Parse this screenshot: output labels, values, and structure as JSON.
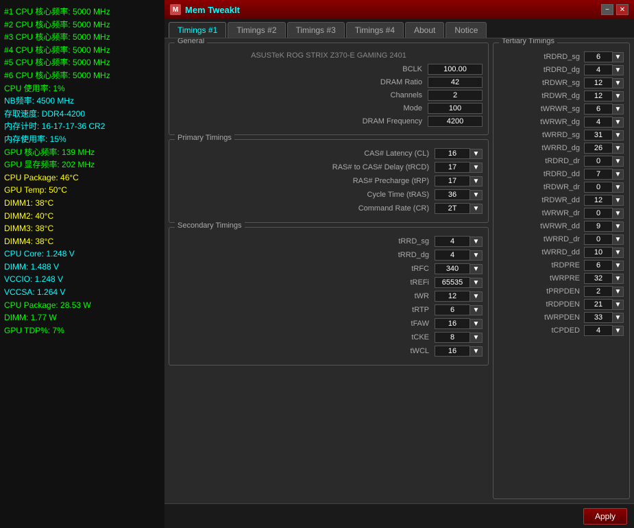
{
  "sidebar": {
    "lines": [
      {
        "text": "#1 CPU 核心频率: 5000 MHz",
        "class": "green"
      },
      {
        "text": "#2 CPU 核心频率: 5000 MHz",
        "class": "green"
      },
      {
        "text": "#3 CPU 核心频率: 5000 MHz",
        "class": "green"
      },
      {
        "text": "#4 CPU 核心频率: 5000 MHz",
        "class": "green"
      },
      {
        "text": "#5 CPU 核心频率: 5000 MHz",
        "class": "green"
      },
      {
        "text": "#6 CPU 核心频率: 5000 MHz",
        "class": "green"
      },
      {
        "text": "CPU 使用率: 1%",
        "class": "green"
      },
      {
        "text": "NB频率: 4500 MHz",
        "class": "cyan"
      },
      {
        "text": "存取速度: DDR4-4200",
        "class": "cyan"
      },
      {
        "text": "内存计时: 16-17-17-36 CR2",
        "class": "cyan"
      },
      {
        "text": "内存使用率: 15%",
        "class": "cyan"
      },
      {
        "text": "GPU 核心频率: 139 MHz",
        "class": "green"
      },
      {
        "text": "GPU 显存频率: 202 MHz",
        "class": "green"
      },
      {
        "text": "CPU Package: 46°C",
        "class": "yellow"
      },
      {
        "text": "GPU Temp: 50°C",
        "class": "yellow"
      },
      {
        "text": "DIMM1: 38°C",
        "class": "yellow"
      },
      {
        "text": "DIMM2: 40°C",
        "class": "yellow"
      },
      {
        "text": "DIMM3: 38°C",
        "class": "yellow"
      },
      {
        "text": "DIMM4: 38°C",
        "class": "yellow"
      },
      {
        "text": "CPU Core: 1.248 V",
        "class": "cyan"
      },
      {
        "text": "DIMM: 1.488 V",
        "class": "cyan"
      },
      {
        "text": "VCCIO: 1.248 V",
        "class": "cyan"
      },
      {
        "text": "VCCSA: 1.264 V",
        "class": "cyan"
      },
      {
        "text": "CPU Package: 28.53 W",
        "class": "green"
      },
      {
        "text": "DIMM: 1.77 W",
        "class": "green"
      },
      {
        "text": "GPU TDP%: 7%",
        "class": "green"
      }
    ]
  },
  "window": {
    "title": "Mem TweakIt",
    "minimize": "−",
    "close": "✕"
  },
  "tabs": [
    {
      "label": "Timings #1",
      "active": true
    },
    {
      "label": "Timings #2",
      "active": false
    },
    {
      "label": "Timings #3",
      "active": false
    },
    {
      "label": "Timings #4",
      "active": false
    },
    {
      "label": "About",
      "active": false
    },
    {
      "label": "Notice",
      "active": false
    }
  ],
  "general": {
    "title": "General",
    "motherboard": "ASUSTeK ROG STRIX Z370-E GAMING 2401",
    "fields": [
      {
        "label": "BCLK",
        "value": "100.00"
      },
      {
        "label": "DRAM Ratio",
        "value": "42"
      },
      {
        "label": "Channels",
        "value": "2"
      },
      {
        "label": "Mode",
        "value": "100"
      },
      {
        "label": "DRAM Frequency",
        "value": "4200"
      }
    ]
  },
  "primary": {
    "title": "Primary Timings",
    "timings": [
      {
        "label": "CAS# Latency (CL)",
        "value": "16"
      },
      {
        "label": "RAS# to CAS# Delay (tRCD)",
        "value": "17"
      },
      {
        "label": "RAS# Precharge (tRP)",
        "value": "17"
      },
      {
        "label": "Cycle Time (tRAS)",
        "value": "36"
      },
      {
        "label": "Command Rate (CR)",
        "value": "2T"
      }
    ]
  },
  "secondary": {
    "title": "Secondary Timings",
    "timings": [
      {
        "label": "tRRD_sg",
        "value": "4"
      },
      {
        "label": "tRRD_dg",
        "value": "4"
      },
      {
        "label": "tRFC",
        "value": "340"
      },
      {
        "label": "tREFi",
        "value": "65535"
      },
      {
        "label": "tWR",
        "value": "12"
      },
      {
        "label": "tRTP",
        "value": "6"
      },
      {
        "label": "tFAW",
        "value": "16"
      },
      {
        "label": "tCKE",
        "value": "8"
      },
      {
        "label": "tWCL",
        "value": "16"
      }
    ]
  },
  "tertiary": {
    "title": "Tertiary Timings",
    "timings": [
      {
        "label": "tRDRD_sg",
        "value": "6"
      },
      {
        "label": "tRDRD_dg",
        "value": "4"
      },
      {
        "label": "tRDWR_sg",
        "value": "12"
      },
      {
        "label": "tRDWR_dg",
        "value": "12"
      },
      {
        "label": "tWRWR_sg",
        "value": "6"
      },
      {
        "label": "tWRWR_dg",
        "value": "4"
      },
      {
        "label": "tWRRD_sg",
        "value": "31"
      },
      {
        "label": "tWRRD_dg",
        "value": "26"
      },
      {
        "label": "tRDRD_dr",
        "value": "0"
      },
      {
        "label": "tRDRD_dd",
        "value": "7"
      },
      {
        "label": "tRDWR_dr",
        "value": "0"
      },
      {
        "label": "tRDWR_dd",
        "value": "12"
      },
      {
        "label": "tWRWR_dr",
        "value": "0"
      },
      {
        "label": "tWRWR_dd",
        "value": "9"
      },
      {
        "label": "tWRRD_dr",
        "value": "0"
      },
      {
        "label": "tWRRD_dd",
        "value": "10"
      },
      {
        "label": "tRDPRE",
        "value": "6"
      },
      {
        "label": "tWRPRE",
        "value": "32"
      },
      {
        "label": "tPRPDEN",
        "value": "2"
      },
      {
        "label": "tRDPDEN",
        "value": "21"
      },
      {
        "label": "tWRPDEN",
        "value": "33"
      },
      {
        "label": "tCPDED",
        "value": "4"
      }
    ]
  },
  "bottom": {
    "apply_label": "Apply"
  }
}
